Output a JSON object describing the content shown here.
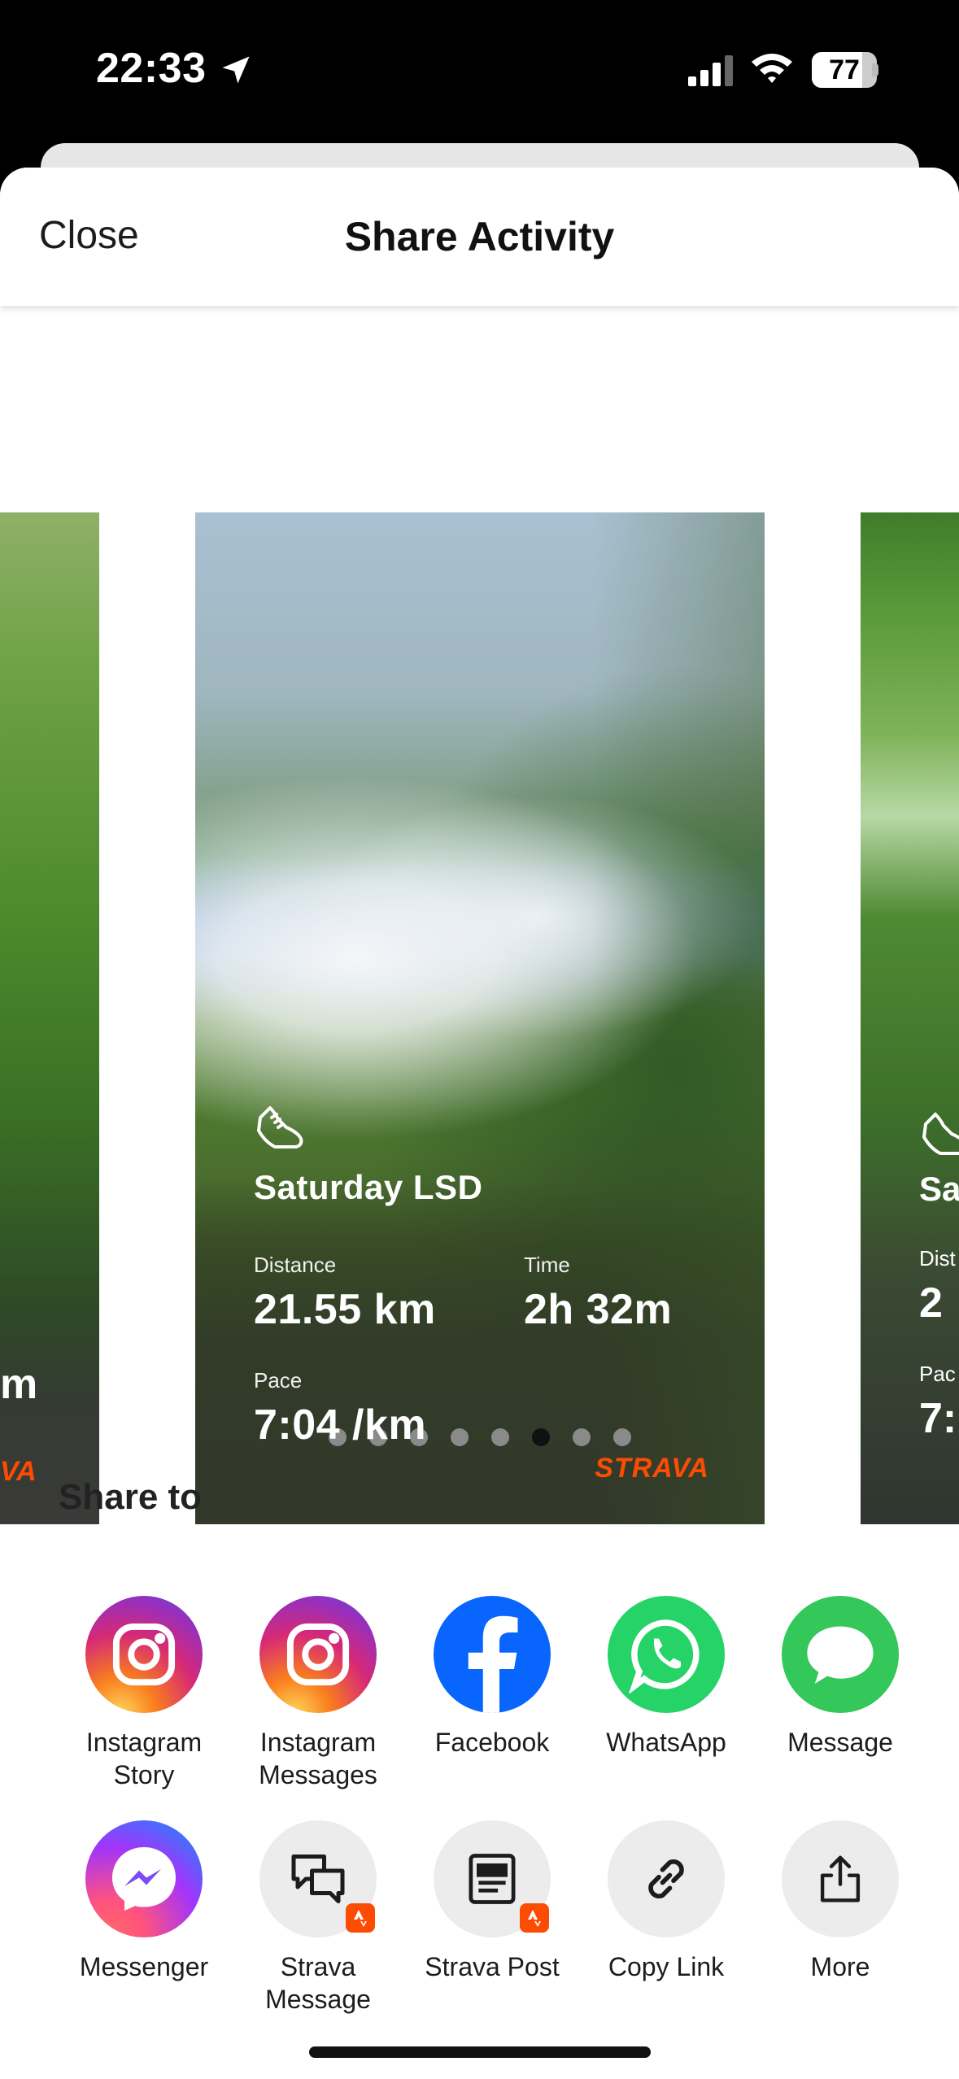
{
  "status_bar": {
    "time": "22:33",
    "battery": "77",
    "battery_level": 0.77
  },
  "header": {
    "close_label": "Close",
    "title": "Share Activity"
  },
  "card": {
    "activity_name": "Saturday LSD",
    "distance_label": "Distance",
    "distance_value": "21.55 km",
    "time_label": "Time",
    "time_value": "2h 32m",
    "pace_label": "Pace",
    "pace_value": "7:04 /km",
    "brand": "STRAVA"
  },
  "left_card_partial": {
    "value_fragment": "m",
    "brand_fragment": "VA"
  },
  "right_card_partial": {
    "title_fragment": "Sa",
    "distance_label_fragment": "Dist",
    "distance_value_fragment": "2",
    "pace_label_fragment": "Pac",
    "pace_value_fragment": "7:"
  },
  "carousel": {
    "page_count": 8,
    "active_page": 6
  },
  "share": {
    "heading": "Share to",
    "targets": [
      {
        "label": "Instagram\nStory",
        "icon": "instagram-icon"
      },
      {
        "label": "Instagram\nMessages",
        "icon": "instagram-icon"
      },
      {
        "label": "Facebook",
        "icon": "facebook-icon"
      },
      {
        "label": "WhatsApp",
        "icon": "whatsapp-icon"
      },
      {
        "label": "Message",
        "icon": "message-bubble-icon"
      },
      {
        "label": "Messenger",
        "icon": "messenger-icon"
      },
      {
        "label": "Strava\nMessage",
        "icon": "chat-bubbles-icon"
      },
      {
        "label": "Strava Post",
        "icon": "post-icon"
      },
      {
        "label": "Copy Link",
        "icon": "link-icon"
      },
      {
        "label": "More",
        "icon": "share-icon"
      }
    ]
  },
  "colors": {
    "strava_orange": "#fc4c02",
    "facebook_blue": "#0866ff",
    "whatsapp_green": "#25d366",
    "message_green": "#34c759"
  }
}
